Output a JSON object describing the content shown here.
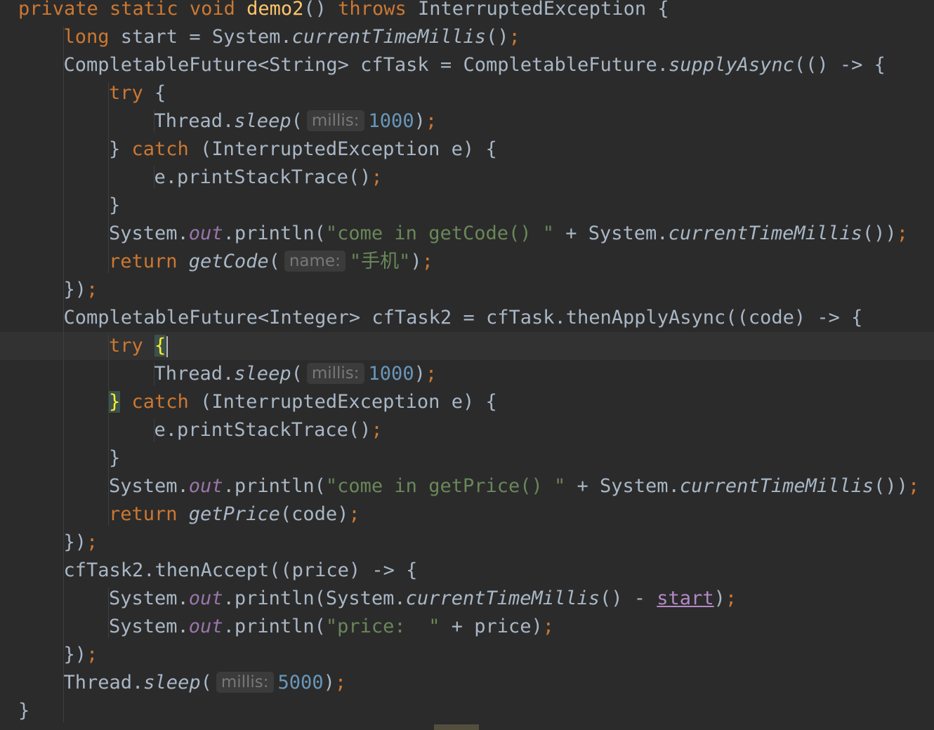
{
  "editor": {
    "lines": [
      {
        "indent": 0,
        "tokens": [
          {
            "t": "private static void ",
            "c": "keyword"
          },
          {
            "t": "demo2",
            "c": "method-decl"
          },
          {
            "t": "() ",
            "c": "plain"
          },
          {
            "t": "throws ",
            "c": "keyword"
          },
          {
            "t": "InterruptedException {",
            "c": "plain"
          }
        ]
      },
      {
        "indent": 1,
        "tokens": [
          {
            "t": "long ",
            "c": "keyword"
          },
          {
            "t": "start = System.",
            "c": "plain"
          },
          {
            "t": "currentTimeMillis",
            "c": "static-method"
          },
          {
            "t": "()",
            "c": "plain"
          },
          {
            "t": ";",
            "c": "semi"
          }
        ]
      },
      {
        "indent": 1,
        "tokens": [
          {
            "t": "CompletableFuture<String> cfTask = CompletableFuture.",
            "c": "plain"
          },
          {
            "t": "supplyAsync",
            "c": "static-method"
          },
          {
            "t": "(() -> {",
            "c": "plain"
          }
        ]
      },
      {
        "indent": 2,
        "tokens": [
          {
            "t": "try ",
            "c": "keyword"
          },
          {
            "t": "{",
            "c": "plain"
          }
        ]
      },
      {
        "indent": 3,
        "tokens": [
          {
            "t": "Thread.",
            "c": "plain"
          },
          {
            "t": "sleep",
            "c": "static-method"
          },
          {
            "t": "(",
            "c": "plain"
          },
          {
            "hint": "millis:"
          },
          {
            "t": "1000",
            "c": "number"
          },
          {
            "t": ")",
            "c": "plain"
          },
          {
            "t": ";",
            "c": "semi"
          }
        ]
      },
      {
        "indent": 2,
        "tokens": [
          {
            "t": "} ",
            "c": "plain"
          },
          {
            "t": "catch ",
            "c": "keyword"
          },
          {
            "t": "(InterruptedException e) {",
            "c": "plain"
          }
        ]
      },
      {
        "indent": 3,
        "tokens": [
          {
            "t": "e.printStackTrace()",
            "c": "plain"
          },
          {
            "t": ";",
            "c": "semi"
          }
        ]
      },
      {
        "indent": 2,
        "tokens": [
          {
            "t": "}",
            "c": "plain"
          }
        ]
      },
      {
        "indent": 2,
        "tokens": [
          {
            "t": "System.",
            "c": "plain"
          },
          {
            "t": "out",
            "c": "field"
          },
          {
            "t": ".println(",
            "c": "plain"
          },
          {
            "t": "\"come in getCode() \"",
            "c": "string"
          },
          {
            "t": " + System.",
            "c": "plain"
          },
          {
            "t": "currentTimeMillis",
            "c": "static-method"
          },
          {
            "t": "())",
            "c": "plain"
          },
          {
            "t": ";",
            "c": "semi"
          }
        ]
      },
      {
        "indent": 2,
        "tokens": [
          {
            "t": "return ",
            "c": "keyword"
          },
          {
            "t": "getCode",
            "c": "static-method"
          },
          {
            "t": "(",
            "c": "plain"
          },
          {
            "hint": "name:"
          },
          {
            "t": "\"手机\"",
            "c": "string"
          },
          {
            "t": ")",
            "c": "plain"
          },
          {
            "t": ";",
            "c": "semi"
          }
        ]
      },
      {
        "indent": 1,
        "tokens": [
          {
            "t": "})",
            "c": "plain"
          },
          {
            "t": ";",
            "c": "semi"
          }
        ]
      },
      {
        "indent": 1,
        "tokens": [
          {
            "t": "CompletableFuture<Integer> cfTask2 = cfTask.thenApplyAsync((code) -> {",
            "c": "plain"
          }
        ]
      },
      {
        "indent": 2,
        "current": true,
        "tokens": [
          {
            "t": "try ",
            "c": "keyword"
          },
          {
            "t": "{",
            "c": "brace-match"
          },
          {
            "caret": true
          }
        ]
      },
      {
        "indent": 3,
        "tokens": [
          {
            "t": "Thread.",
            "c": "plain"
          },
          {
            "t": "sleep",
            "c": "static-method"
          },
          {
            "t": "(",
            "c": "plain"
          },
          {
            "hint": "millis:"
          },
          {
            "t": "1000",
            "c": "number"
          },
          {
            "t": ")",
            "c": "plain"
          },
          {
            "t": ";",
            "c": "semi"
          }
        ]
      },
      {
        "indent": 2,
        "tokens": [
          {
            "t": "}",
            "c": "brace-match"
          },
          {
            "t": " ",
            "c": "plain"
          },
          {
            "t": "catch ",
            "c": "keyword"
          },
          {
            "t": "(InterruptedException e) {",
            "c": "plain"
          }
        ]
      },
      {
        "indent": 3,
        "tokens": [
          {
            "t": "e.printStackTrace()",
            "c": "plain"
          },
          {
            "t": ";",
            "c": "semi"
          }
        ]
      },
      {
        "indent": 2,
        "tokens": [
          {
            "t": "}",
            "c": "plain"
          }
        ]
      },
      {
        "indent": 2,
        "tokens": [
          {
            "t": "System.",
            "c": "plain"
          },
          {
            "t": "out",
            "c": "field"
          },
          {
            "t": ".println(",
            "c": "plain"
          },
          {
            "t": "\"come in getPrice() \"",
            "c": "string"
          },
          {
            "t": " + System.",
            "c": "plain"
          },
          {
            "t": "currentTimeMillis",
            "c": "static-method"
          },
          {
            "t": "())",
            "c": "plain"
          },
          {
            "t": ";",
            "c": "semi"
          }
        ]
      },
      {
        "indent": 2,
        "tokens": [
          {
            "t": "return ",
            "c": "keyword"
          },
          {
            "t": "getPrice",
            "c": "static-method"
          },
          {
            "t": "(code)",
            "c": "plain"
          },
          {
            "t": ";",
            "c": "semi"
          }
        ]
      },
      {
        "indent": 1,
        "tokens": [
          {
            "t": "})",
            "c": "plain"
          },
          {
            "t": ";",
            "c": "semi"
          }
        ]
      },
      {
        "indent": 1,
        "tokens": [
          {
            "t": "cfTask2.thenAccept((price) -> {",
            "c": "plain"
          }
        ]
      },
      {
        "indent": 2,
        "tokens": [
          {
            "t": "System.",
            "c": "plain"
          },
          {
            "t": "out",
            "c": "field"
          },
          {
            "t": ".println(System.",
            "c": "plain"
          },
          {
            "t": "currentTimeMillis",
            "c": "static-method"
          },
          {
            "t": "() - ",
            "c": "plain"
          },
          {
            "t": "start",
            "c": "local-underlined"
          },
          {
            "t": ")",
            "c": "plain"
          },
          {
            "t": ";",
            "c": "semi"
          }
        ]
      },
      {
        "indent": 2,
        "tokens": [
          {
            "t": "System.",
            "c": "plain"
          },
          {
            "t": "out",
            "c": "field"
          },
          {
            "t": ".println(",
            "c": "plain"
          },
          {
            "t": "\"price:  \"",
            "c": "string"
          },
          {
            "t": " + price)",
            "c": "plain"
          },
          {
            "t": ";",
            "c": "semi"
          }
        ]
      },
      {
        "indent": 1,
        "tokens": [
          {
            "t": "})",
            "c": "plain"
          },
          {
            "t": ";",
            "c": "semi"
          }
        ]
      },
      {
        "indent": 1,
        "tokens": [
          {
            "t": "Thread.",
            "c": "plain"
          },
          {
            "t": "sleep",
            "c": "static-method"
          },
          {
            "t": "(",
            "c": "plain"
          },
          {
            "hint": "millis:"
          },
          {
            "t": "5000",
            "c": "number"
          },
          {
            "t": ")",
            "c": "plain"
          },
          {
            "t": ";",
            "c": "semi"
          }
        ]
      },
      {
        "indent": 0,
        "tokens": [
          {
            "t": "}",
            "c": "plain"
          }
        ]
      }
    ]
  }
}
